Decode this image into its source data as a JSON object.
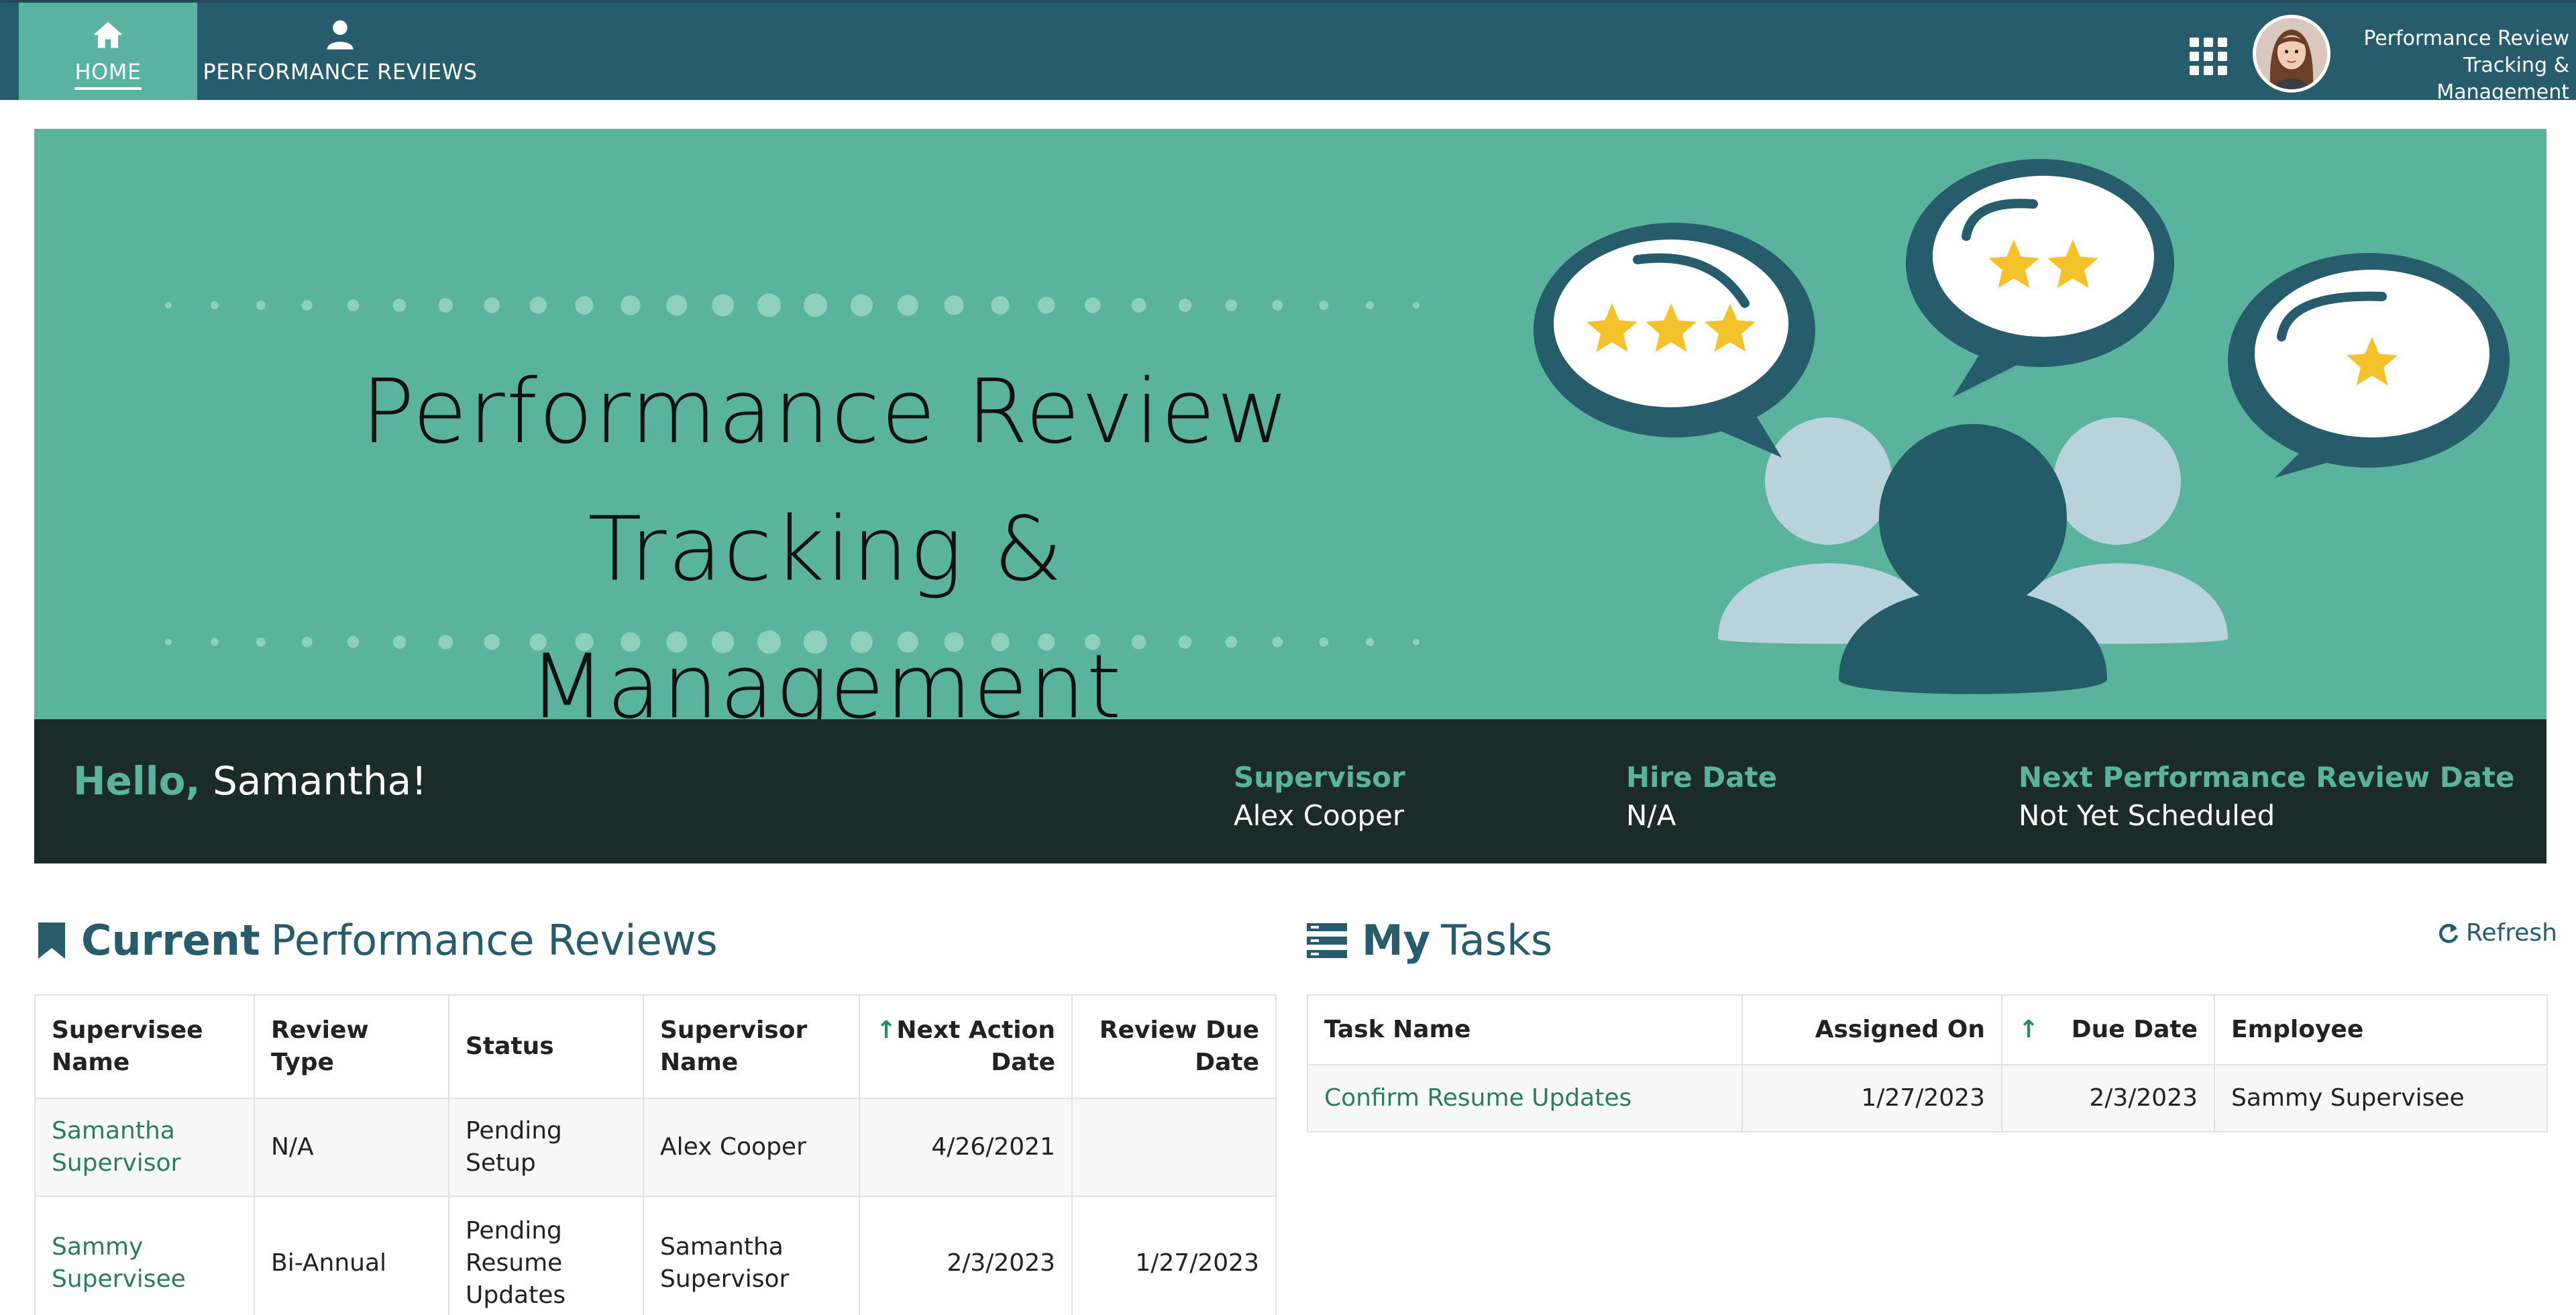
{
  "nav": {
    "home_label": "HOME",
    "reviews_label": "PERFORMANCE REVIEWS",
    "brand_line1": "Performance Review",
    "brand_line2": "Tracking & Management"
  },
  "banner": {
    "title_line1": "Performance Review Tracking &",
    "title_line2": "Management",
    "ratings": [
      3,
      2,
      1
    ]
  },
  "welcome": {
    "greeting": "Hello,",
    "name": "Samantha!",
    "supervisor_label": "Supervisor",
    "supervisor_value": "Alex Cooper",
    "hire_label": "Hire Date",
    "hire_value": "N/A",
    "next_review_label": "Next Performance Review Date",
    "next_review_value": "Not Yet Scheduled"
  },
  "reviews": {
    "title_bold": "Current",
    "title_rest": "Performance Reviews",
    "columns": [
      "Supervisee Name",
      "Review Type",
      "Status",
      "Supervisor Name",
      "Next Action Date",
      "Review Due Date"
    ],
    "sort_indicator": "↑",
    "rows": [
      {
        "supervisee": "Samantha Supervisor",
        "type": "N/A",
        "status": "Pending Setup",
        "supervisor": "Alex Cooper",
        "next_action": "4/26/2021",
        "due": ""
      },
      {
        "supervisee": "Sammy Supervisee",
        "type": "Bi-Annual",
        "status": "Pending Resume Updates",
        "supervisor": "Samantha Supervisor",
        "next_action": "2/3/2023",
        "due": "1/27/2023"
      }
    ]
  },
  "tasks": {
    "title_bold": "My",
    "title_rest": "Tasks",
    "refresh_label": "Refresh",
    "columns": [
      "Task Name",
      "Assigned On",
      "Due Date",
      "Employee"
    ],
    "sort_indicator": "↑",
    "rows": [
      {
        "task": "Confirm Resume Updates",
        "assigned": "1/27/2023",
        "due": "2/3/2023",
        "employee": "Sammy Supervisee"
      }
    ]
  },
  "colors": {
    "nav_bg": "#265c6b",
    "accent": "#5ab39d",
    "dark_strip": "#1b2b27",
    "link": "#2a7d5f"
  }
}
